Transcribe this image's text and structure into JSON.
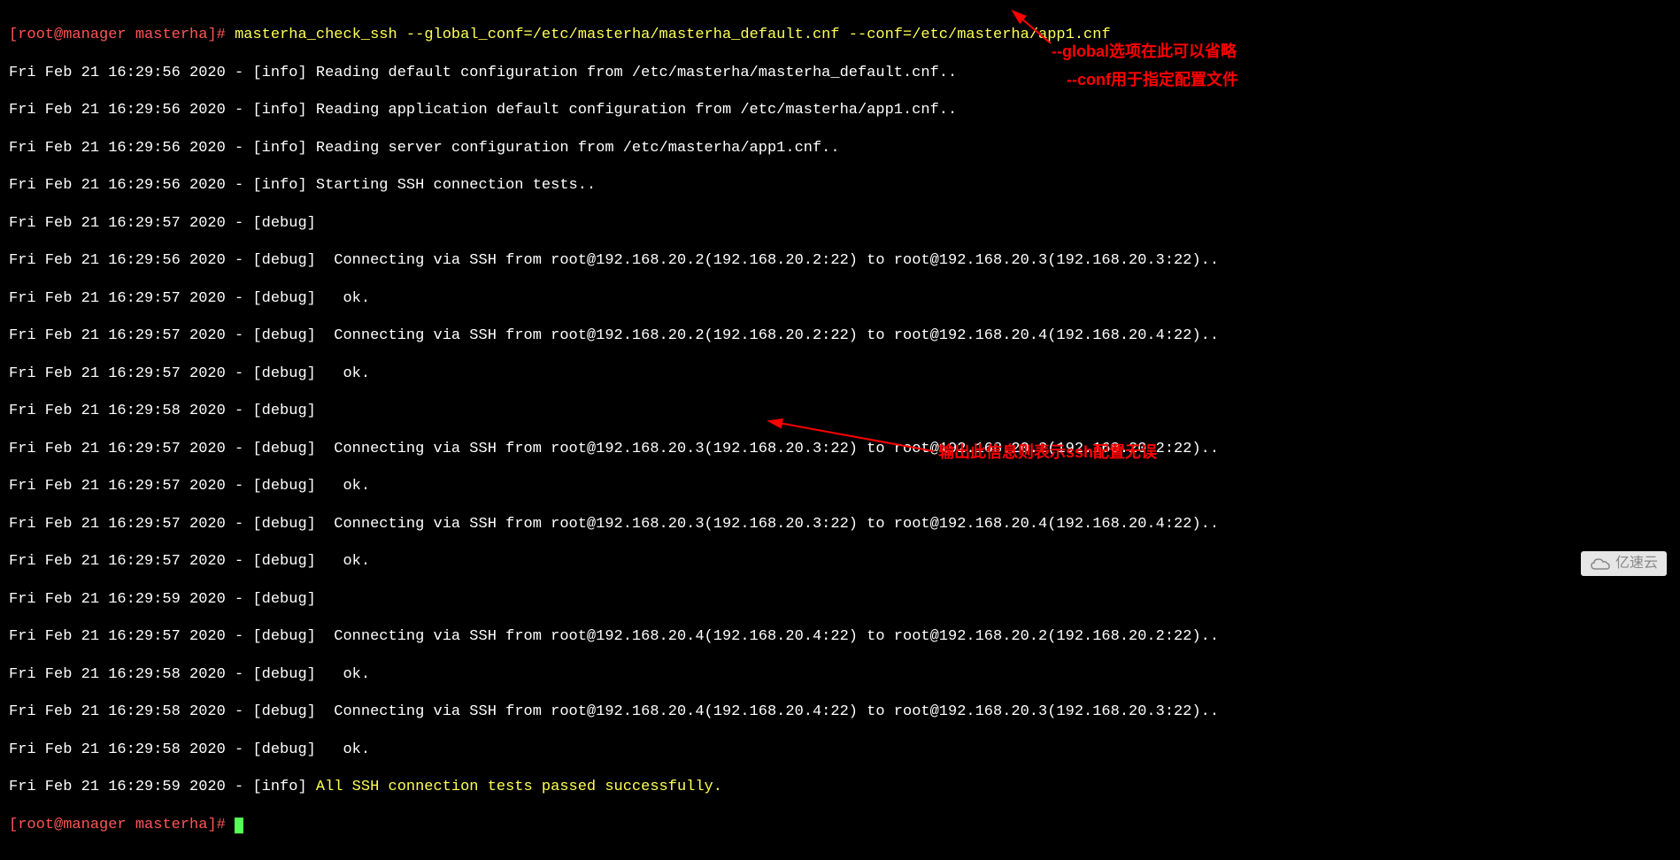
{
  "prompt": {
    "open": "[",
    "user": "root",
    "at": "@",
    "host": "manager",
    "space": " ",
    "path": "masterha",
    "close": "]",
    "hash": "# "
  },
  "command": "masterha_check_ssh --global_conf=/etc/masterha/masterha_default.cnf --conf=/etc/masterha/app1.cnf",
  "lines": [
    {
      "ts": "Fri Feb 21 16:29:56 2020 - ",
      "tag": "[info] ",
      "msg": "Reading default configuration from /etc/masterha/masterha_default.cnf.."
    },
    {
      "ts": "Fri Feb 21 16:29:56 2020 - ",
      "tag": "[info] ",
      "msg": "Reading application default configuration from /etc/masterha/app1.cnf.."
    },
    {
      "ts": "Fri Feb 21 16:29:56 2020 - ",
      "tag": "[info] ",
      "msg": "Reading server configuration from /etc/masterha/app1.cnf.."
    },
    {
      "ts": "Fri Feb 21 16:29:56 2020 - ",
      "tag": "[info] ",
      "msg": "Starting SSH connection tests.."
    },
    {
      "ts": "Fri Feb 21 16:29:57 2020 - ",
      "tag": "[debug] ",
      "msg": ""
    },
    {
      "ts": "Fri Feb 21 16:29:56 2020 - ",
      "tag": "[debug]  ",
      "msg": "Connecting via SSH from root@192.168.20.2(192.168.20.2:22) to root@192.168.20.3(192.168.20.3:22).."
    },
    {
      "ts": "Fri Feb 21 16:29:57 2020 - ",
      "tag": "[debug]   ",
      "msg": "ok."
    },
    {
      "ts": "Fri Feb 21 16:29:57 2020 - ",
      "tag": "[debug]  ",
      "msg": "Connecting via SSH from root@192.168.20.2(192.168.20.2:22) to root@192.168.20.4(192.168.20.4:22).."
    },
    {
      "ts": "Fri Feb 21 16:29:57 2020 - ",
      "tag": "[debug]   ",
      "msg": "ok."
    },
    {
      "ts": "Fri Feb 21 16:29:58 2020 - ",
      "tag": "[debug] ",
      "msg": ""
    },
    {
      "ts": "Fri Feb 21 16:29:57 2020 - ",
      "tag": "[debug]  ",
      "msg": "Connecting via SSH from root@192.168.20.3(192.168.20.3:22) to root@192.168.20.2(192.168.20.2:22).."
    },
    {
      "ts": "Fri Feb 21 16:29:57 2020 - ",
      "tag": "[debug]   ",
      "msg": "ok."
    },
    {
      "ts": "Fri Feb 21 16:29:57 2020 - ",
      "tag": "[debug]  ",
      "msg": "Connecting via SSH from root@192.168.20.3(192.168.20.3:22) to root@192.168.20.4(192.168.20.4:22).."
    },
    {
      "ts": "Fri Feb 21 16:29:57 2020 - ",
      "tag": "[debug]   ",
      "msg": "ok."
    },
    {
      "ts": "Fri Feb 21 16:29:59 2020 - ",
      "tag": "[debug] ",
      "msg": ""
    },
    {
      "ts": "Fri Feb 21 16:29:57 2020 - ",
      "tag": "[debug]  ",
      "msg": "Connecting via SSH from root@192.168.20.4(192.168.20.4:22) to root@192.168.20.2(192.168.20.2:22).."
    },
    {
      "ts": "Fri Feb 21 16:29:58 2020 - ",
      "tag": "[debug]   ",
      "msg": "ok."
    },
    {
      "ts": "Fri Feb 21 16:29:58 2020 - ",
      "tag": "[debug]  ",
      "msg": "Connecting via SSH from root@192.168.20.4(192.168.20.4:22) to root@192.168.20.3(192.168.20.3:22).."
    },
    {
      "ts": "Fri Feb 21 16:29:58 2020 - ",
      "tag": "[debug]   ",
      "msg": "ok."
    }
  ],
  "success_line": {
    "ts": "Fri Feb 21 16:29:59 2020 - ",
    "tag": "[info] ",
    "msg": "All SSH connection tests passed successfully."
  },
  "annotations": {
    "a1": "--global选项在此可以省略",
    "a2": "--conf用于指定配置文件",
    "a3": "输出此信息则表示ssh配置无误"
  },
  "watermark": "亿速云"
}
